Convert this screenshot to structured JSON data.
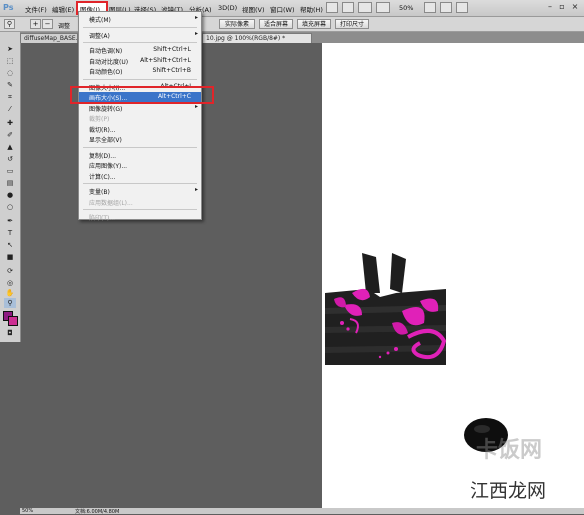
{
  "menubar": {
    "logo": "Ps",
    "items": [
      "文件(F)",
      "编辑(E)",
      "图像(I)",
      "图层(L)",
      "选择(S)",
      "滤镜(T)",
      "分析(A)",
      "3D(D)",
      "视图(V)",
      "窗口(W)",
      "帮助(H)"
    ],
    "zoom": "50%"
  },
  "options": {
    "checkbox_label": "调整",
    "buttons": [
      "实际像素",
      "适合屏幕",
      "填充屏幕",
      "打印尺寸"
    ]
  },
  "tabs": [
    "diffuseMap_BASE.d",
    "10.jpg @ 100%(RGB/8#) *"
  ],
  "image_menu": [
    {
      "label": "模式(M)",
      "shortcut": "",
      "submenu": true,
      "enabled": true
    },
    {
      "sep": true
    },
    {
      "label": "调整(A)",
      "shortcut": "",
      "submenu": true,
      "enabled": true
    },
    {
      "sep": true
    },
    {
      "label": "自动色调(N)",
      "shortcut": "Shift+Ctrl+L",
      "enabled": true
    },
    {
      "label": "自动对比度(U)",
      "shortcut": "Alt+Shift+Ctrl+L",
      "enabled": true
    },
    {
      "label": "自动颜色(O)",
      "shortcut": "Shift+Ctrl+B",
      "enabled": true
    },
    {
      "sep": true
    },
    {
      "label": "图像大小(I)...",
      "shortcut": "Alt+Ctrl+I",
      "enabled": true
    },
    {
      "label": "画布大小(S)...",
      "shortcut": "Alt+Ctrl+C",
      "enabled": true,
      "active": true
    },
    {
      "label": "图像旋转(G)",
      "shortcut": "",
      "submenu": true,
      "enabled": true
    },
    {
      "label": "裁剪(P)",
      "shortcut": "",
      "enabled": false
    },
    {
      "label": "裁切(R)...",
      "shortcut": "",
      "enabled": true
    },
    {
      "label": "显示全部(V)",
      "shortcut": "",
      "enabled": true
    },
    {
      "sep": true
    },
    {
      "label": "复制(D)...",
      "shortcut": "",
      "enabled": true
    },
    {
      "label": "应用图像(Y)...",
      "shortcut": "",
      "enabled": true
    },
    {
      "label": "计算(C)...",
      "shortcut": "",
      "enabled": true
    },
    {
      "sep": true
    },
    {
      "label": "变量(B)",
      "shortcut": "",
      "submenu": true,
      "enabled": true
    },
    {
      "label": "应用数据组(L)...",
      "shortcut": "",
      "enabled": false
    },
    {
      "sep": true
    },
    {
      "label": "陷印(T)...",
      "shortcut": "",
      "enabled": false
    }
  ],
  "watermark": "卡饭网",
  "watermark2": "江西龙网",
  "status": {
    "zoom": "50%",
    "doc": "文档:6.00M/4.80M"
  },
  "colors": {
    "foreground": "#8e1a82",
    "background": "#cc2f93",
    "highlight": "#e0252a",
    "active": "#3a74c9"
  }
}
